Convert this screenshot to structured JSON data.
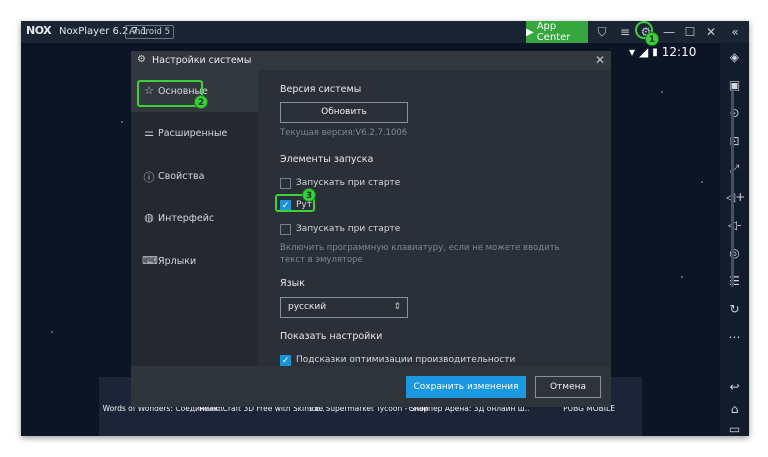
{
  "titlebar": {
    "logo": "NOX",
    "app_name": "NoxPlayer 6.2.7.1",
    "android": "Android 5",
    "app_center": "App Center"
  },
  "status": {
    "time": "12:10"
  },
  "dialog": {
    "title": "Настройки системы",
    "nav": [
      {
        "label": "Основные",
        "icon": "star-icon"
      },
      {
        "label": "Расширенные",
        "icon": "sliders-icon"
      },
      {
        "label": "Свойства",
        "icon": "info-icon"
      },
      {
        "label": "Интерфейс",
        "icon": "palette-icon"
      },
      {
        "label": "Ярлыки",
        "icon": "keyboard-icon"
      }
    ],
    "system_version": {
      "title": "Версия системы",
      "update_button": "Обновить",
      "current_version": "Текущая версия:V6.2.7.1006"
    },
    "launch": {
      "title": "Элементы запуска",
      "items": [
        {
          "label": "Запускать при старте",
          "checked": false
        },
        {
          "label": "Рут",
          "checked": true
        },
        {
          "label": "Запускать при старте",
          "checked": false
        }
      ],
      "note": "Включить программную клавиатуру, если не можете вводить текст в эмуляторе"
    },
    "language": {
      "title": "Язык",
      "value": "русский"
    },
    "show_settings": {
      "title": "Показать настройки",
      "items": [
        {
          "label": "Подсказки оптимизации производительности",
          "checked": true
        }
      ]
    },
    "footer": {
      "save": "Сохранить изменения",
      "cancel": "Отмена"
    }
  },
  "dock": {
    "apps": [
      {
        "label": "Words of Wonders: Соединялк..",
        "color": "#3d6fb3"
      },
      {
        "label": "RealmCraft 3D Free with Skins E..",
        "color": "#8a5a2a"
      },
      {
        "label": "Idle Supermarket Tycoon - Shop",
        "color": "#4a8ec4"
      },
      {
        "label": "Снайпер Арена: 3Д онлайн ш..",
        "color": "#9b8b6a"
      },
      {
        "label": "PUBG MOBILE",
        "color": "#c9a64a"
      }
    ]
  },
  "annotations": {
    "m1": "1",
    "m2": "2",
    "m3": "3"
  },
  "colors": {
    "accent": "#1b98e0",
    "highlight": "#3bd13b",
    "app_center": "#36a63e"
  }
}
